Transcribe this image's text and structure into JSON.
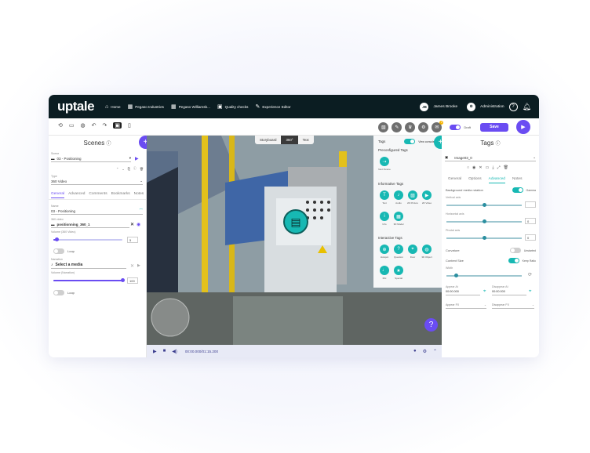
{
  "topbar": {
    "logo": "uptale",
    "nav": [
      {
        "icon": "home-icon",
        "label": "Home"
      },
      {
        "icon": "building-icon",
        "label": "Pegaso Industries"
      },
      {
        "icon": "building-icon",
        "label": "Pegaso Williamsb..."
      },
      {
        "icon": "folder-icon",
        "label": "Quality checks"
      },
      {
        "icon": "pencil-icon",
        "label": "Experience Editor"
      }
    ],
    "user_initials": "JB",
    "user_name": "James Brooke",
    "role": "Administration",
    "help": "?"
  },
  "toolbar": {
    "tools": [
      "history-icon",
      "subtitles-icon",
      "globe-icon",
      "undo-icon",
      "redo-icon",
      "vr-icon",
      "mobile-icon"
    ],
    "draft_label": "Draft",
    "save_label": "Save",
    "badge_count": "2"
  },
  "left_panel": {
    "title": "Scenes",
    "scene_label": "Scene",
    "scene_value": "03 - Positioning",
    "type_label": "Type",
    "type_value": "360 Video",
    "tabs": [
      "General",
      "Advanced",
      "Comments",
      "Bookmarks",
      "Notes"
    ],
    "name_label": "Name",
    "name_value": "03 - Positioning",
    "video_label": "360 video",
    "video_value": "positionning_360_1",
    "volume_label": "Volume (360 Video)",
    "volume_value": "5",
    "volume_level": 0.05,
    "loop_label": "Loop",
    "narration_label": "Narration",
    "narration_value": "Select a media",
    "narration_volume_label": "Volume (Narration)",
    "narration_volume_value": "100",
    "narration_level": 1.0,
    "loop2_label": "Loop"
  },
  "viewport": {
    "modes": [
      "Storyboard",
      "360°",
      "Text"
    ],
    "active_mode": "360°",
    "timecode": "00:00.000/01:15.200",
    "tags_title": "Tags",
    "view_console_label": "View console",
    "preconfigured_title": "Preconfigured Tags",
    "preconfigured": [
      {
        "icon": "nav-icon",
        "label": "Next Scene"
      }
    ],
    "informative_title": "Informative Tags",
    "informative": [
      {
        "icon": "text-icon",
        "label": "Text"
      },
      {
        "icon": "audio-icon",
        "label": "Audio"
      },
      {
        "icon": "image-icon",
        "label": "2D Picture"
      },
      {
        "icon": "video-icon",
        "label": "2D Video"
      },
      {
        "icon": "info-icon",
        "label": "Info"
      },
      {
        "icon": "image-icon",
        "label": "3D Model"
      }
    ],
    "interactive_title": "Interactive Tags",
    "interactive": [
      {
        "icon": "quiz-icon",
        "label": "Hotspot"
      },
      {
        "icon": "question-icon",
        "label": "Question"
      },
      {
        "icon": "pin-icon",
        "label": "Door"
      },
      {
        "icon": "globe-icon",
        "label": "3D Object"
      },
      {
        "icon": "mic-icon",
        "label": "Mic"
      },
      {
        "icon": "star-icon",
        "label": "Special"
      }
    ]
  },
  "right_panel": {
    "title": "Tags",
    "image_value": "Image03_0",
    "tabs": [
      "General",
      "Options",
      "Advanced",
      "Notes"
    ],
    "active_tab": "Advanced",
    "bg_rotation_label": "Background media rotation",
    "gamma_label": "Gamma",
    "vertical_label": "Vertical axis",
    "vertical_value": "",
    "horizontal_label": "Horizontal axis",
    "horizontal_value": "0",
    "pivotal_label": "Pivotal axis",
    "pivotal_value": "0",
    "curvature_label": "Curvature",
    "curvature_state": "Unstarted",
    "contentsize_label": "Content Size",
    "contentsize_state": "Keep Ratio",
    "width_label": "Width",
    "appear_label": "Appear At",
    "appear_value": "00:00.000",
    "disappear_label": "Disappear At",
    "disappear_value": "00:00.000",
    "appear_fx_label": "Appear FX",
    "disappear_fx_label": "Disappear FX"
  }
}
